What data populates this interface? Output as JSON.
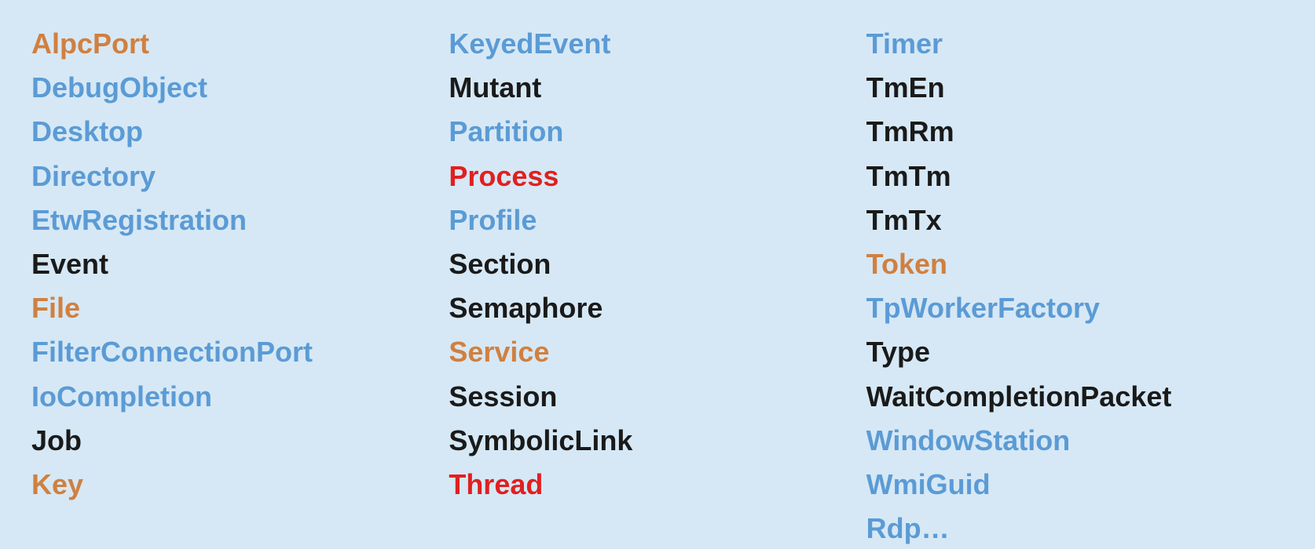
{
  "columns": [
    {
      "id": "col1",
      "items": [
        {
          "label": "AlpcPort",
          "color": "orange"
        },
        {
          "label": "DebugObject",
          "color": "blue"
        },
        {
          "label": "Desktop",
          "color": "blue"
        },
        {
          "label": "Directory",
          "color": "blue"
        },
        {
          "label": "EtwRegistration",
          "color": "blue"
        },
        {
          "label": "Event",
          "color": "black"
        },
        {
          "label": "File",
          "color": "orange"
        },
        {
          "label": "FilterConnectionPort",
          "color": "blue"
        },
        {
          "label": "IoCompletion",
          "color": "blue"
        },
        {
          "label": "Job",
          "color": "black"
        },
        {
          "label": "Key",
          "color": "orange"
        }
      ]
    },
    {
      "id": "col2",
      "items": [
        {
          "label": "KeyedEvent",
          "color": "blue"
        },
        {
          "label": "Mutant",
          "color": "black"
        },
        {
          "label": "Partition",
          "color": "blue"
        },
        {
          "label": "Process",
          "color": "red"
        },
        {
          "label": "Profile",
          "color": "blue"
        },
        {
          "label": "Section",
          "color": "black"
        },
        {
          "label": "Semaphore",
          "color": "black"
        },
        {
          "label": "Service",
          "color": "orange"
        },
        {
          "label": "Session",
          "color": "black"
        },
        {
          "label": "SymbolicLink",
          "color": "black"
        },
        {
          "label": "Thread",
          "color": "red"
        }
      ]
    },
    {
      "id": "col3",
      "items": [
        {
          "label": "Timer",
          "color": "blue"
        },
        {
          "label": "TmEn",
          "color": "black"
        },
        {
          "label": "TmRm",
          "color": "black"
        },
        {
          "label": "TmTm",
          "color": "black"
        },
        {
          "label": "TmTx",
          "color": "black"
        },
        {
          "label": "Token",
          "color": "orange"
        },
        {
          "label": "TpWorkerFactory",
          "color": "blue"
        },
        {
          "label": "Type",
          "color": "black"
        },
        {
          "label": "WaitCompletionPacket",
          "color": "black"
        },
        {
          "label": "WindowStation",
          "color": "blue"
        },
        {
          "label": "WmiGuid",
          "color": "blue"
        },
        {
          "label": "Rdp…",
          "color": "blue"
        }
      ]
    }
  ],
  "colors": {
    "blue": "#5b9bd5",
    "orange": "#d08040",
    "black": "#1a1a1a",
    "red": "#e02020"
  }
}
